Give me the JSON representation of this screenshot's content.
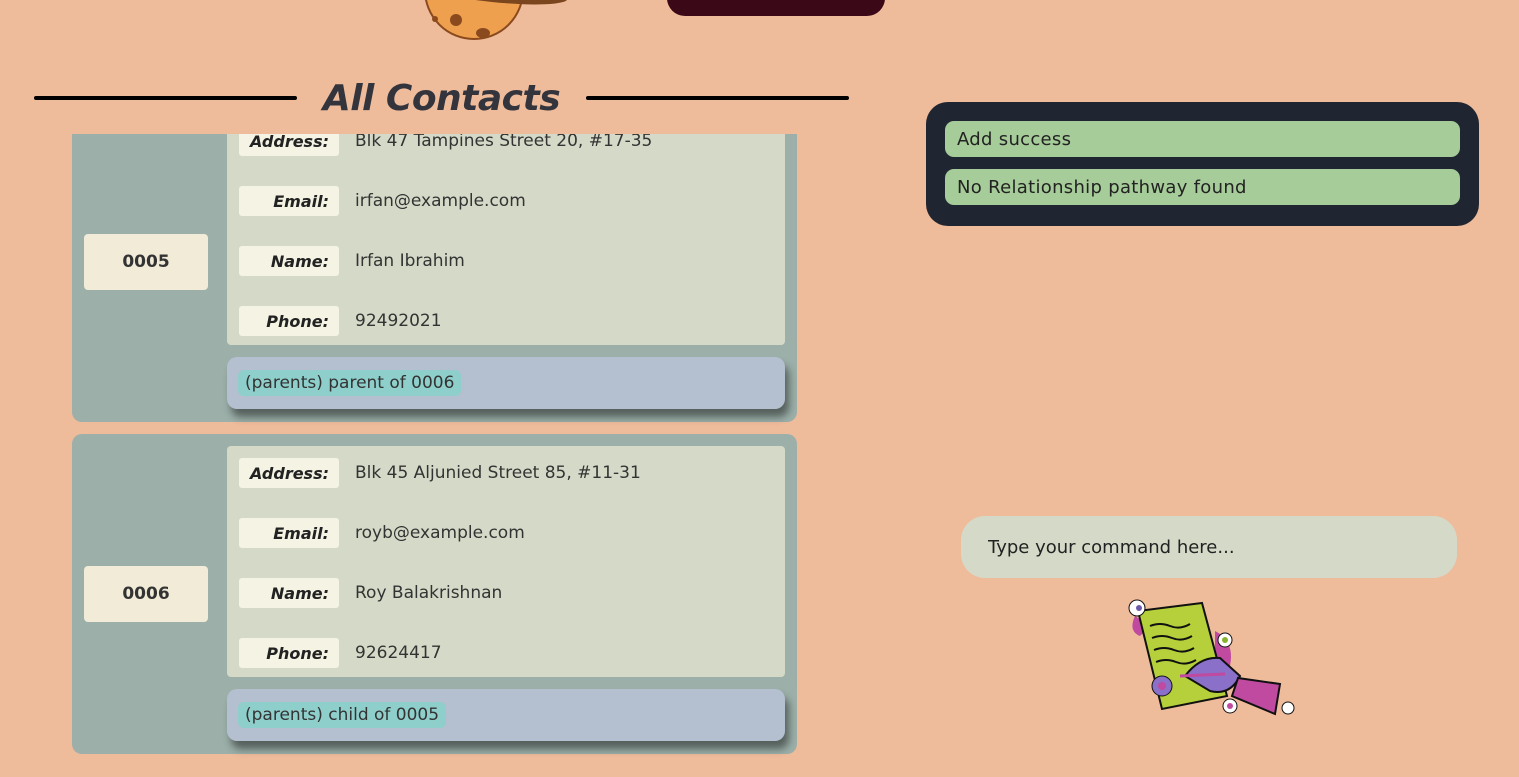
{
  "header": {
    "title": "All Contacts"
  },
  "contacts": [
    {
      "id": "0005",
      "address_label": "Address:",
      "address": "Blk 47 Tampines Street 20, #17-35",
      "email_label": "Email:",
      "email": "irfan@example.com",
      "name_label": "Name:",
      "name": "Irfan Ibrahim",
      "phone_label": "Phone:",
      "phone": "92492021",
      "relationship": "(parents) parent of 0006"
    },
    {
      "id": "0006",
      "address_label": "Address:",
      "address": "Blk 45 Aljunied Street 85, #11-31",
      "email_label": "Email:",
      "email": "royb@example.com",
      "name_label": "Name:",
      "name": "Roy Balakrishnan",
      "phone_label": "Phone:",
      "phone": "92624417",
      "relationship": "(parents) child of 0005"
    }
  ],
  "results": {
    "messages": [
      "Add success",
      "No Relationship pathway found"
    ]
  },
  "command": {
    "placeholder": "Type your command here..."
  },
  "colors": {
    "background": "#eebb9b",
    "card": "#9cafa9",
    "result_panel": "#202631",
    "message": "#a6cc99"
  }
}
